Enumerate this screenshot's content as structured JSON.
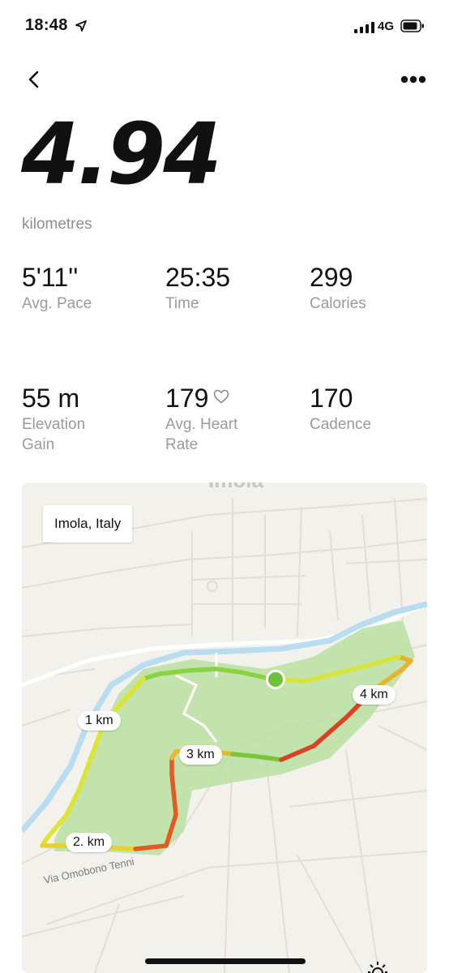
{
  "status": {
    "time": "18:48",
    "network": "4G"
  },
  "run": {
    "distance": "4.94",
    "unit": "kilometres"
  },
  "stats": [
    {
      "value": "5'11''",
      "label": "Avg. Pace"
    },
    {
      "value": "25:35",
      "label": "Time"
    },
    {
      "value": "299",
      "label": "Calories"
    },
    {
      "value": "55 m",
      "label": "Elevation Gain"
    },
    {
      "value": "179",
      "label": "Avg. Heart Rate"
    },
    {
      "value": "170",
      "label": "Cadence"
    }
  ],
  "map": {
    "location": "Imola, Italy",
    "top_city_label": "Imola",
    "street_label": "Via Omobono Tenni",
    "markers": [
      "1 km",
      "2. km",
      "3 km",
      "4 km"
    ]
  },
  "icons": {
    "back": "chevron-left-icon",
    "more": "more-horizontal-icon",
    "heart": "heart-outline-icon",
    "location": "location-arrow-icon"
  },
  "colors": {
    "park": "#b9e0a0",
    "river": "#b8dcf0",
    "route_green": "#74c43a",
    "route_yellow": "#e4e034",
    "route_red": "#d9361c",
    "current_dot": "#6cc33b"
  }
}
